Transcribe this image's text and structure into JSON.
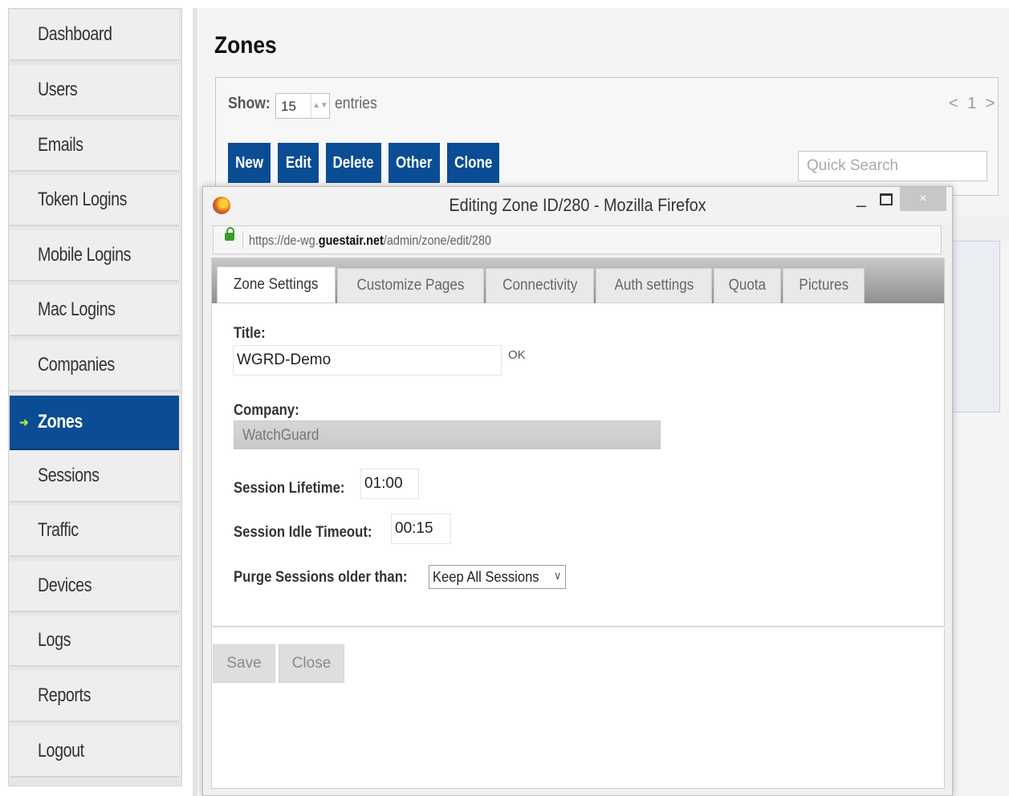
{
  "sidebar": {
    "items": [
      {
        "label": "Dashboard"
      },
      {
        "label": "Users"
      },
      {
        "label": "Emails"
      },
      {
        "label": "Token Logins"
      },
      {
        "label": "Mobile Logins"
      },
      {
        "label": "Mac Logins"
      },
      {
        "label": "Companies"
      },
      {
        "label": "Zones",
        "active": true
      },
      {
        "label": "Sessions"
      },
      {
        "label": "Traffic"
      },
      {
        "label": "Devices"
      },
      {
        "label": "Logs"
      },
      {
        "label": "Reports"
      },
      {
        "label": "Logout"
      }
    ],
    "active_color": "#0a4d94"
  },
  "page": {
    "title": "Zones",
    "show_label": "Show:",
    "entries_value": "15",
    "entries_label": "entries",
    "pager": "< 1 >",
    "toolbar": {
      "new": "New",
      "edit": "Edit",
      "delete": "Delete",
      "other": "Other",
      "clone": "Clone"
    },
    "quick_search_placeholder": "Quick Search"
  },
  "popup": {
    "window_title": "Editing Zone ID/280 - Mozilla Firefox",
    "url_prefix": "https://de-wg.",
    "url_domain": "guestair.net",
    "url_path": "/admin/zone/edit/280",
    "close_glyph": "×",
    "minimize_glyph": "–",
    "tabs": [
      {
        "label": "Zone Settings",
        "active": true
      },
      {
        "label": "Customize Pages"
      },
      {
        "label": "Connectivity"
      },
      {
        "label": "Auth settings"
      },
      {
        "label": "Quota"
      },
      {
        "label": "Pictures"
      }
    ],
    "form": {
      "title_label": "Title:",
      "title_value": "WGRD-Demo",
      "title_ok": "OK",
      "company_label": "Company:",
      "company_value": "WatchGuard",
      "lifetime_label": "Session Lifetime:",
      "lifetime_value": "01:00",
      "idle_label": "Session Idle Timeout:",
      "idle_value": "00:15",
      "purge_label": "Purge Sessions older than:",
      "purge_value": "Keep All Sessions"
    },
    "buttons": {
      "save": "Save",
      "close": "Close"
    }
  }
}
